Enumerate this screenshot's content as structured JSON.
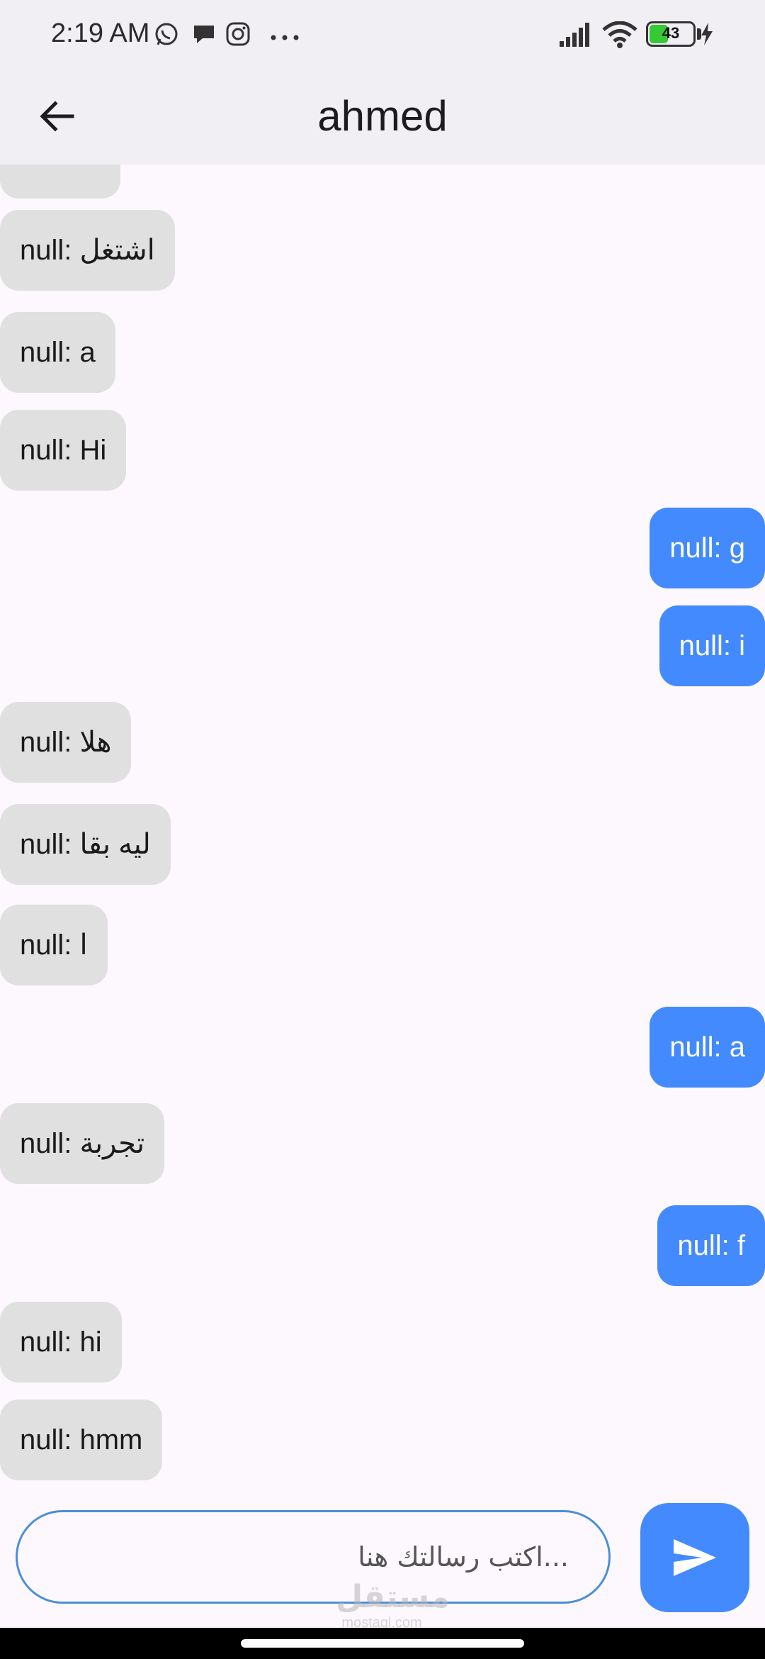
{
  "status_bar": {
    "time": "2:19 AM",
    "battery_level": "43",
    "battery_fraction": 0.43,
    "icons": [
      "whatsapp-icon",
      "chat-bubble-icon",
      "instagram-icon",
      "more-dots-icon",
      "signal-icon",
      "wifi-icon",
      "battery-icon",
      "charging-icon"
    ]
  },
  "app_bar": {
    "title": "ahmed",
    "back_icon": "arrow-left-icon"
  },
  "messages": [
    {
      "text": "",
      "type": "received"
    },
    {
      "text": "null: اشتغل",
      "type": "received"
    },
    {
      "text": "null: a",
      "type": "received"
    },
    {
      "text": "null: Hi",
      "type": "received"
    },
    {
      "text": "null: g",
      "type": "sent"
    },
    {
      "text": "null: i",
      "type": "sent"
    },
    {
      "text": "null: هلا",
      "type": "received"
    },
    {
      "text": "null: ليه بقا",
      "type": "received"
    },
    {
      "text": "null: ا",
      "type": "received"
    },
    {
      "text": "null: a",
      "type": "sent"
    },
    {
      "text": "null: تجربة",
      "type": "received"
    },
    {
      "text": "null: f",
      "type": "sent"
    },
    {
      "text": "null: hi",
      "type": "received"
    },
    {
      "text": "null: hmm",
      "type": "received"
    }
  ],
  "composer": {
    "placeholder": "...اكتب رسالتك هنا",
    "value": "",
    "send_icon": "send-icon"
  },
  "watermark": {
    "arabic": "مستقل",
    "latin": "mostaql.com"
  },
  "colors": {
    "sent_bubble": "#448aff",
    "received_bubble": "#e0e0e0",
    "app_bar": "#f1eff4",
    "background": "#fdf8fd",
    "input_border": "#4a8fd9"
  }
}
